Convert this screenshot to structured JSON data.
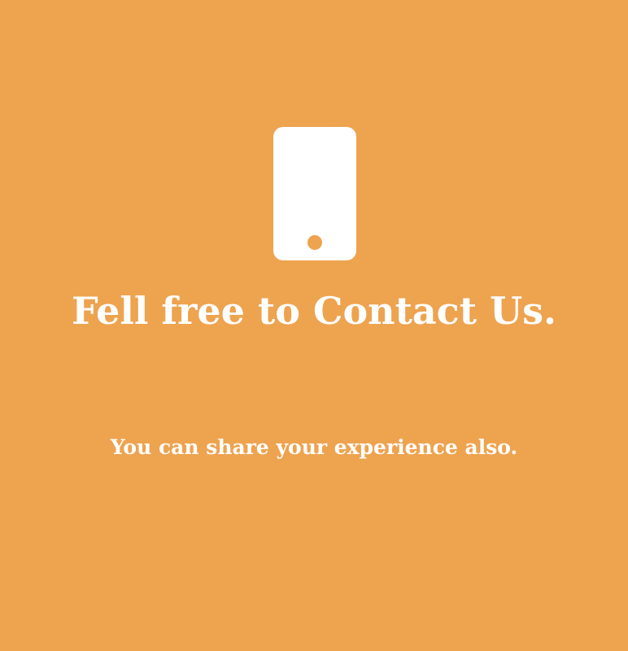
{
  "colors": {
    "background": "#EEA34F",
    "foreground": "#FFFFFF"
  },
  "contact": {
    "icon": "mobile-phone-icon",
    "title": "Fell free to Contact Us.",
    "subtitle": "You can share your experience also."
  }
}
